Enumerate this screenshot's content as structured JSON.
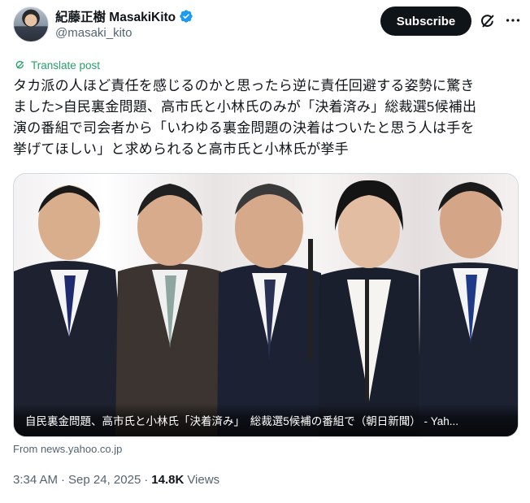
{
  "author": {
    "display_name": "紀藤正樹 MasakiKito",
    "handle": "@masaki_kito",
    "verified_icon": "verified-badge-icon"
  },
  "actions": {
    "subscribe_label": "Subscribe",
    "grok_icon": "grok-icon",
    "more_icon": "more-horizontal-icon"
  },
  "translate": {
    "label": "Translate post",
    "icon": "translate-icon"
  },
  "post": {
    "lines": [
      "タカ派の人ほど責任を感じるのかと思ったら逆に責任回避する姿勢に驚き",
      "ました>自民裏金問題、高市氏と小林氏のみが「決着済み」総裁選5候補出",
      "演の番組で司会者から「いわゆる裏金問題の決着はついたと思う人は手を",
      "挙げてほしい」と求められると高市氏と小林氏が挙手"
    ]
  },
  "media": {
    "caption": "自民裏金問題、高市氏と小林氏「決着済み」　総裁選5候補の番組で（朝日新聞） - Yah...",
    "source": "From news.yahoo.co.jp"
  },
  "meta": {
    "time": "3:34 AM",
    "separator1": "·",
    "date": "Sep 24, 2025",
    "separator2": "·",
    "views_count": "14.8K",
    "views_label": "Views"
  },
  "colors": {
    "accent_green": "#28a06b",
    "verified_blue": "#1d9bf0",
    "text_primary": "#0f1419",
    "text_secondary": "#536471",
    "stage_red": "#b3112a"
  }
}
